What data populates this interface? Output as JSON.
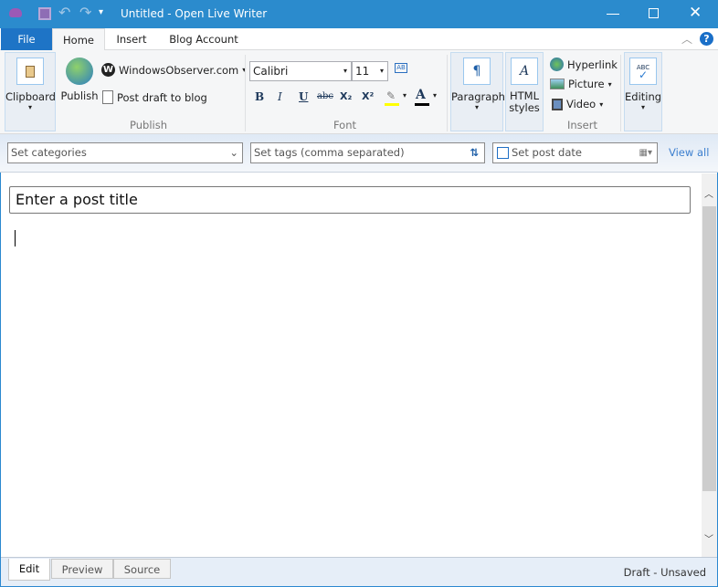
{
  "window": {
    "title": "Untitled - Open Live Writer"
  },
  "ribbon_tabs": [
    "File",
    "Home",
    "Insert",
    "Blog Account"
  ],
  "publish_group": {
    "clipboard": "Clipboard",
    "publish": "Publish",
    "blog": "WindowsObserver.com",
    "post_draft": "Post draft to blog",
    "label": "Publish"
  },
  "font_group": {
    "font": "Calibri",
    "size": "11",
    "label": "Font",
    "bold": "B",
    "italic": "I",
    "underline": "U",
    "strike": "abc",
    "subscript": "X₂",
    "superscript": "X²",
    "font_color": "A"
  },
  "paragraph": "Paragraph",
  "html_styles": "HTML styles",
  "insert_group": {
    "hyperlink": "Hyperlink",
    "picture": "Picture",
    "video": "Video",
    "label": "Insert"
  },
  "editing": "Editing",
  "meta": {
    "categories_placeholder": "Set categories",
    "tags_placeholder": "Set tags (comma separated)",
    "post_date": "Set post date",
    "view_all": "View all"
  },
  "editor": {
    "title_placeholder": "Enter a post title"
  },
  "bottom_tabs": [
    "Edit",
    "Preview",
    "Source"
  ],
  "status": "Draft - Unsaved",
  "colors": {
    "accent": "#2b8bcd",
    "highlight": "#ffff00"
  }
}
